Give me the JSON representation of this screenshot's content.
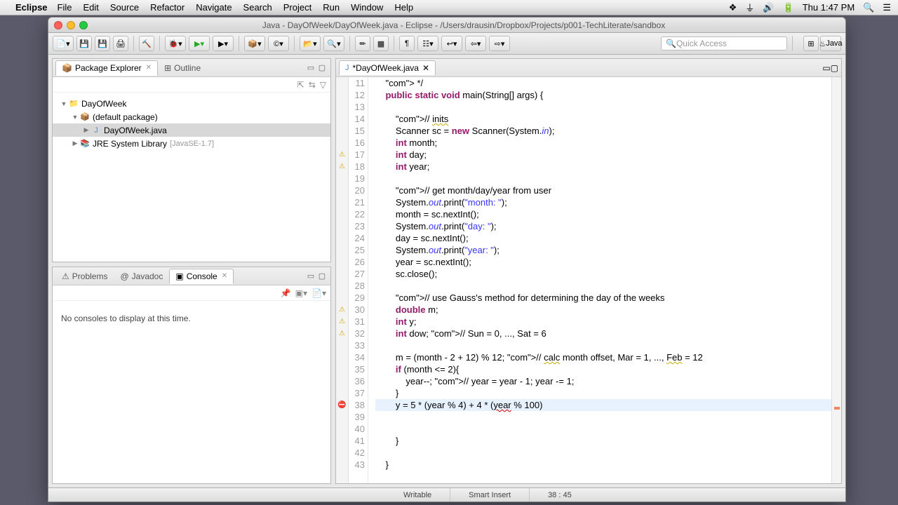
{
  "menubar": {
    "app": "Eclipse",
    "items": [
      "File",
      "Edit",
      "Source",
      "Refactor",
      "Navigate",
      "Search",
      "Project",
      "Run",
      "Window",
      "Help"
    ],
    "clock": "Thu 1:47 PM"
  },
  "window": {
    "title": "Java - DayOfWeek/DayOfWeek.java - Eclipse - /Users/drausin/Dropbox/Projects/p001-TechLiterate/sandbox"
  },
  "quick_access_placeholder": "Quick Access",
  "perspective_label": "Java",
  "package_explorer": {
    "tab": "Package Explorer",
    "outline_tab": "Outline",
    "project": "DayOfWeek",
    "default_pkg": "(default package)",
    "file": "DayOfWeek.java",
    "jre": "JRE System Library",
    "jre_ver": "[JavaSE-1.7]"
  },
  "bottom_view": {
    "tabs": [
      "Problems",
      "Javadoc",
      "Console"
    ],
    "active": "Console",
    "message": "No consoles to display at this time."
  },
  "editor": {
    "tab": "*DayOfWeek.java",
    "first_line": 11,
    "marks": {
      "17": "warn",
      "18": "warn",
      "30": "warn",
      "31": "warn",
      "32": "warn",
      "38": "err"
    },
    "current_line": 38,
    "lines": [
      " */",
      "public static void main(String[] args) {",
      "",
      "    // inits",
      "    Scanner sc = new Scanner(System.in);",
      "    int month;",
      "    int day;",
      "    int year;",
      "",
      "    // get month/day/year from user",
      "    System.out.print(\"month: \");",
      "    month = sc.nextInt();",
      "    System.out.print(\"day: \");",
      "    day = sc.nextInt();",
      "    System.out.print(\"year: \");",
      "    year = sc.nextInt();",
      "    sc.close();",
      "",
      "    // use Gauss's method for determining the day of the weeks",
      "    double m;",
      "    int y;",
      "    int dow; // Sun = 0, ..., Sat = 6",
      "",
      "    m = (month - 2 + 12) % 12; // calc month offset, Mar = 1, ..., Feb = 12",
      "    if (month <= 2){",
      "        year--; // year = year - 1; year -= 1;",
      "    }",
      "    y = 5 * (year % 4) + 4 * (year % 100)",
      "",
      "",
      "    }",
      "",
      "}"
    ]
  },
  "status": {
    "writable": "Writable",
    "mode": "Smart Insert",
    "pos": "38 : 45"
  }
}
